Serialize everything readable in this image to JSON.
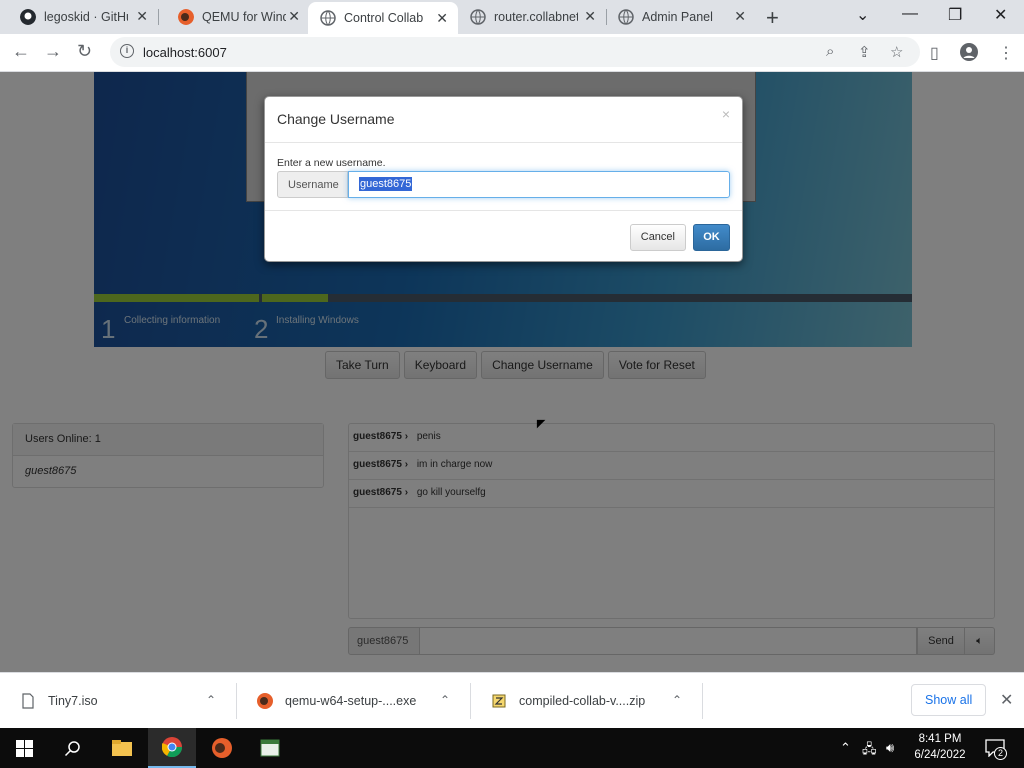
{
  "browser": {
    "tabs": [
      {
        "title": "legoskid · GitHub",
        "icon": "github-icon"
      },
      {
        "title": "QEMU for Windows",
        "icon": "qemu-icon"
      },
      {
        "title": "Control Collab",
        "icon": "globe-icon",
        "active": true
      },
      {
        "title": "router.collabnet",
        "icon": "globe-icon"
      },
      {
        "title": "Admin Panel",
        "icon": "globe-icon"
      }
    ],
    "url": "localhost:6007"
  },
  "vm": {
    "steps": [
      {
        "num": "1",
        "label": "Collecting information"
      },
      {
        "num": "2",
        "label": "Installing Windows"
      }
    ],
    "buttons": {
      "take_turn": "Take Turn",
      "keyboard": "Keyboard",
      "change_username": "Change Username",
      "vote_reset": "Vote for Reset"
    }
  },
  "users": {
    "header": "Users Online: 1",
    "list": [
      "guest8675"
    ]
  },
  "chat": {
    "messages": [
      {
        "user": "guest8675 ›",
        "text": "penis"
      },
      {
        "user": "guest8675 ›",
        "text": "im in charge now"
      },
      {
        "user": "guest8675 ›",
        "text": "go kill yourselfg"
      }
    ],
    "username_addon": "guest8675",
    "send_label": "Send",
    "volume_icon": "speaker-icon"
  },
  "modal": {
    "title": "Change Username",
    "close": "×",
    "prompt": "Enter a new username.",
    "field_label": "Username",
    "field_value": "guest8675",
    "cancel_label": "Cancel",
    "ok_label": "OK"
  },
  "downloads": {
    "items": [
      {
        "name": "Tiny7.iso",
        "icon": "file-icon"
      },
      {
        "name": "qemu-w64-setup-....exe",
        "icon": "qemu-icon"
      },
      {
        "name": "compiled-collab-v....zip",
        "icon": "zip-icon"
      }
    ],
    "show_all": "Show all"
  },
  "taskbar": {
    "time": "8:41 PM",
    "date": "6/24/2022",
    "notifications": "2"
  },
  "colors": {
    "accent": "#428bca",
    "selection": "#3367d6",
    "link": "#1a73e8"
  }
}
